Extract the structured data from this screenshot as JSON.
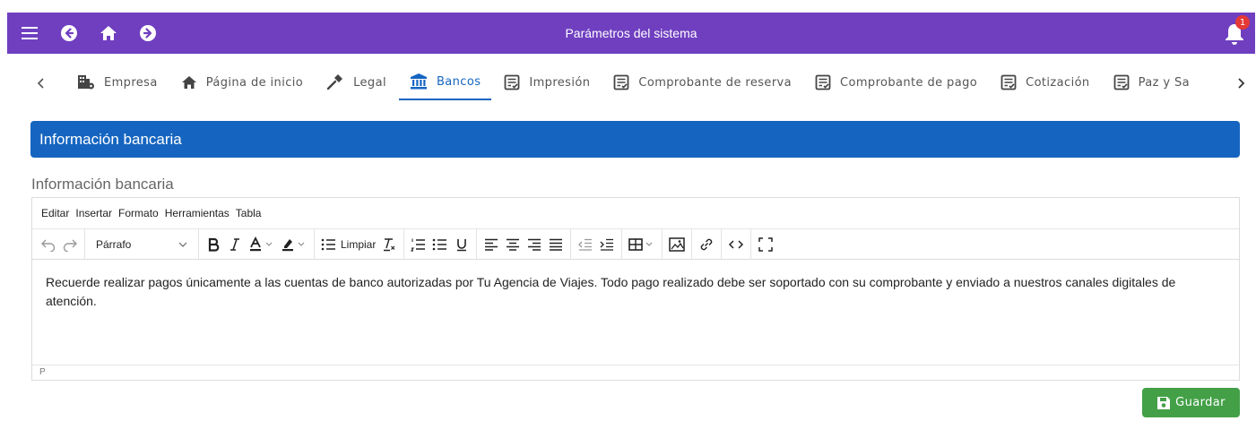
{
  "header": {
    "title": "Parámetros del sistema",
    "notification_count": "1",
    "icons": [
      "menu-icon",
      "back-icon",
      "home-icon",
      "forward-icon",
      "bell-icon"
    ]
  },
  "tabs": [
    {
      "label": "Empresa",
      "icon": "building-settings-icon",
      "active": false
    },
    {
      "label": "Página de inicio",
      "icon": "home-icon",
      "active": false
    },
    {
      "label": "Legal",
      "icon": "gavel-icon",
      "active": false
    },
    {
      "label": "Bancos",
      "icon": "bank-icon",
      "active": true
    },
    {
      "label": "Impresión",
      "icon": "document-check-icon",
      "active": false
    },
    {
      "label": "Comprobante de reserva",
      "icon": "document-check-icon",
      "active": false
    },
    {
      "label": "Comprobante de pago",
      "icon": "document-check-icon",
      "active": false
    },
    {
      "label": "Cotización",
      "icon": "document-check-icon",
      "active": false
    },
    {
      "label": "Paz y Sa",
      "icon": "document-check-icon",
      "active": false
    }
  ],
  "section": {
    "title": "Información bancaria",
    "field_label": "Información bancaria"
  },
  "editor": {
    "menus": [
      "Editar",
      "Insertar",
      "Formato",
      "Herramientas",
      "Tabla"
    ],
    "block_format": "Párrafo",
    "clear_label": "Limpiar",
    "content": "Recuerde realizar pagos únicamente a las cuentas de banco autorizadas por Tu Agencia de Viajes. Todo pago realizado debe ser soportado con su comprobante y enviado a nuestros canales digitales de atención.",
    "status_path": "P"
  },
  "actions": {
    "save_label": "Guardar"
  },
  "colors": {
    "header_bg": "#6f3fc0",
    "section_bg": "#1565c0",
    "active_tab": "#1565c0",
    "save_bg": "#43a047",
    "badge": "#e53935"
  }
}
